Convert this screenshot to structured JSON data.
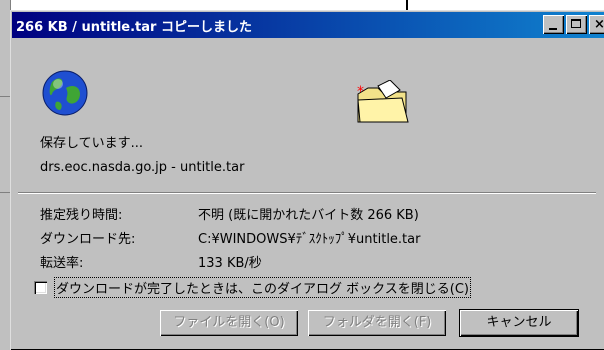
{
  "window": {
    "title": "266 KB / untitle.tar コピーしました",
    "minimize_icon": "minimize-icon",
    "maximize_icon": "maximize-icon",
    "close_icon": "close-icon"
  },
  "status": {
    "saving_text": "保存しています...",
    "source_text": "drs.eoc.nasda.go.jp - untitle.tar"
  },
  "details": [
    {
      "label": "推定残り時間:",
      "value": "不明 (既に開かれたバイト数 266 KB)"
    },
    {
      "label": "ダウンロード先:",
      "value": "C:¥WINDOWS¥ﾃﾞｽｸﾄｯﾌﾟ¥untitle.tar"
    },
    {
      "label": "転送率:",
      "value": "133 KB/秒"
    }
  ],
  "close_on_complete": {
    "label": "ダウンロードが完了したときは、このダイアログ ボックスを閉じる(C)",
    "checked": false
  },
  "buttons": {
    "open_file": "ファイルを開く(O)",
    "open_folder": "フォルダを開く(F)",
    "cancel": "キャンセル"
  },
  "icons": {
    "download_source": "globe-icon",
    "download_target": "folder-icon"
  },
  "colors": {
    "title_bar_start": "#000080",
    "title_bar_end": "#1084d0",
    "dialog_face": "#c0c0c0"
  }
}
